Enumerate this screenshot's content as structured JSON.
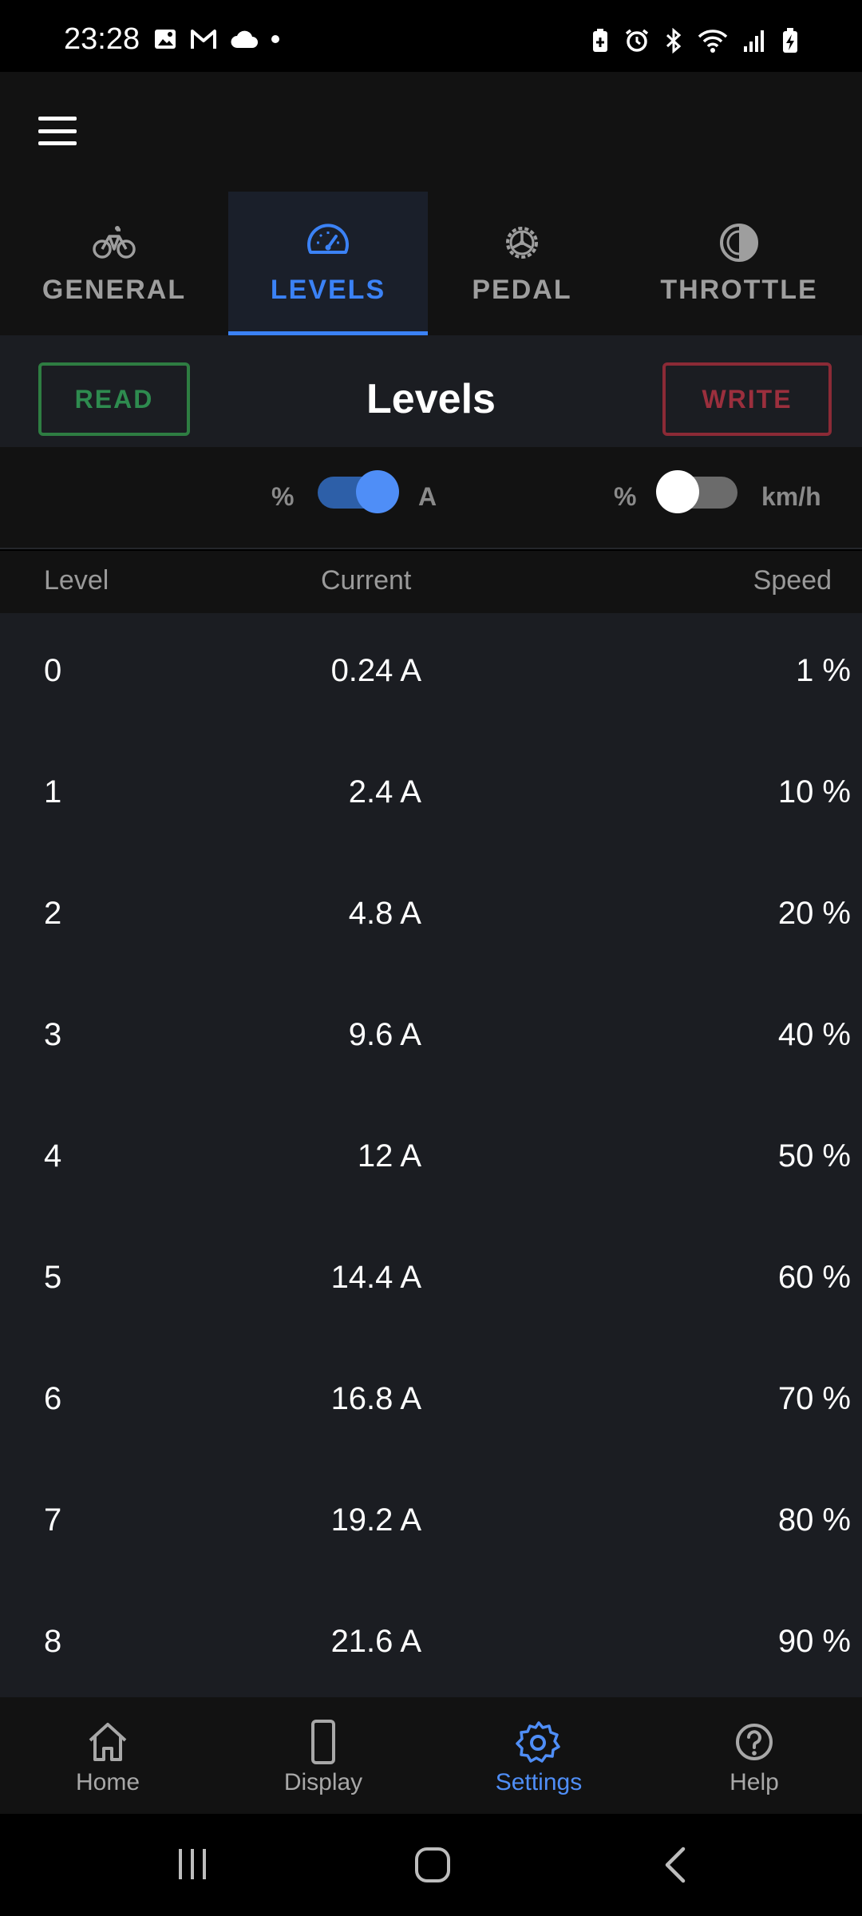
{
  "status_bar": {
    "time": "23:28",
    "left_icons": [
      "image-icon",
      "gmail-icon",
      "cloud-icon",
      "dot-icon"
    ],
    "right_icons": [
      "battery-saver-icon",
      "alarm-icon",
      "bluetooth-icon",
      "wifi-icon",
      "signal-icon",
      "battery-charging-icon"
    ]
  },
  "app_bar": {
    "menu_icon": "hamburger-menu-icon"
  },
  "tabs": [
    {
      "label": "GENERAL",
      "icon": "bicycle-icon",
      "active": false
    },
    {
      "label": "LEVELS",
      "icon": "speedometer-icon",
      "active": true
    },
    {
      "label": "PEDAL",
      "icon": "gear-icon",
      "active": false
    },
    {
      "label": "THROTTLE",
      "icon": "contrast-icon",
      "active": false
    }
  ],
  "header": {
    "read_label": "READ",
    "title": "Levels",
    "write_label": "WRITE"
  },
  "toggles": {
    "current_unit": {
      "left": "%",
      "right": "A",
      "on": true
    },
    "speed_unit": {
      "left": "%",
      "right": "km/h",
      "on": false
    }
  },
  "table": {
    "columns": [
      "Level",
      "Current",
      "Speed"
    ],
    "rows": [
      {
        "level": "0",
        "current": "0.24 A",
        "speed": "1 %"
      },
      {
        "level": "1",
        "current": "2.4 A",
        "speed": "10 %"
      },
      {
        "level": "2",
        "current": "4.8 A",
        "speed": "20 %"
      },
      {
        "level": "3",
        "current": "9.6 A",
        "speed": "40 %"
      },
      {
        "level": "4",
        "current": "12 A",
        "speed": "50 %"
      },
      {
        "level": "5",
        "current": "14.4 A",
        "speed": "60 %"
      },
      {
        "level": "6",
        "current": "16.8 A",
        "speed": "70 %"
      },
      {
        "level": "7",
        "current": "19.2 A",
        "speed": "80 %"
      },
      {
        "level": "8",
        "current": "21.6 A",
        "speed": "90 %"
      }
    ]
  },
  "bottom_nav": [
    {
      "label": "Home",
      "icon": "home-icon",
      "active": false
    },
    {
      "label": "Display",
      "icon": "phone-display-icon",
      "active": false
    },
    {
      "label": "Settings",
      "icon": "settings-gear-icon",
      "active": true
    },
    {
      "label": "Help",
      "icon": "help-circle-icon",
      "active": false
    }
  ],
  "colors": {
    "accent": "#3b82f6",
    "read": "#2e8b4f",
    "write": "#9b2f3d",
    "background": "#1b1d22"
  }
}
